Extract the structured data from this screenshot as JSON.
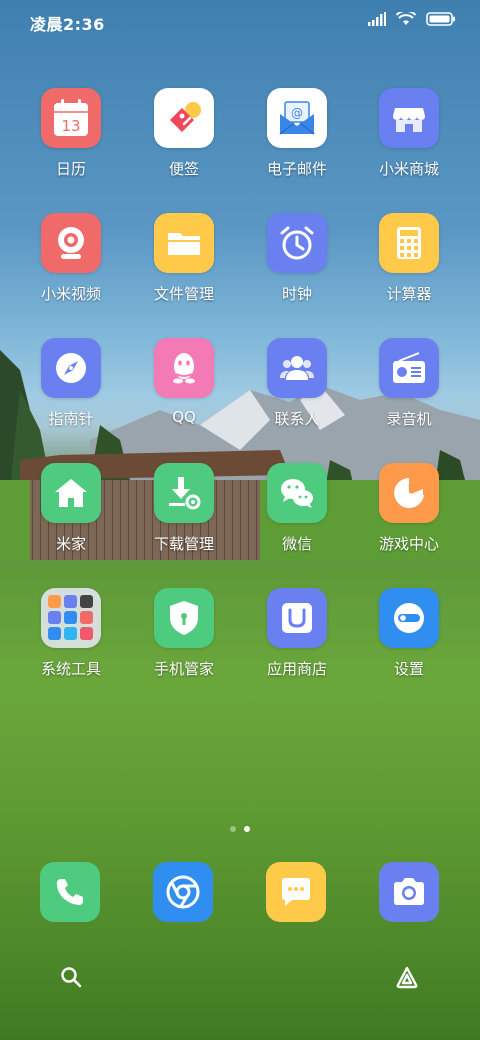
{
  "status_bar": {
    "time": "凌晨2:36"
  },
  "apps": [
    {
      "label": "日历",
      "icon": "calendar-icon",
      "color": "#f06a6a",
      "day": "13"
    },
    {
      "label": "便签",
      "icon": "notes-icon",
      "color": "#ffffff"
    },
    {
      "label": "电子邮件",
      "icon": "email-icon",
      "color": "#ffffff"
    },
    {
      "label": "小米商城",
      "icon": "store-icon",
      "color": "#6a80f0"
    },
    {
      "label": "小米视频",
      "icon": "video-icon",
      "color": "#f06a6a"
    },
    {
      "label": "文件管理",
      "icon": "folder-icon",
      "color": "#ffc94a"
    },
    {
      "label": "时钟",
      "icon": "clock-icon",
      "color": "#6a80f0"
    },
    {
      "label": "计算器",
      "icon": "calculator-icon",
      "color": "#ffc94a"
    },
    {
      "label": "指南针",
      "icon": "compass-icon",
      "color": "#6a80f0"
    },
    {
      "label": "QQ",
      "icon": "qq-icon",
      "color": "#f47ab6"
    },
    {
      "label": "联系人",
      "icon": "contacts-icon",
      "color": "#6a80f0"
    },
    {
      "label": "录音机",
      "icon": "radio-icon",
      "color": "#6a80f0"
    },
    {
      "label": "米家",
      "icon": "home-icon",
      "color": "#4ecb7e"
    },
    {
      "label": "下载管理",
      "icon": "download-icon",
      "color": "#4ecb7e"
    },
    {
      "label": "微信",
      "icon": "wechat-icon",
      "color": "#4ecb7e"
    },
    {
      "label": "游戏中心",
      "icon": "game-icon",
      "color": "#ff9a4a"
    },
    {
      "label": "系统工具",
      "icon": "folder-grid-icon",
      "color": "#d8dde6"
    },
    {
      "label": "手机管家",
      "icon": "security-icon",
      "color": "#4ecb7e"
    },
    {
      "label": "应用商店",
      "icon": "app-store-icon",
      "color": "#6a80f0"
    },
    {
      "label": "设置",
      "icon": "settings-icon",
      "color": "#2f8ef0"
    }
  ],
  "dock": [
    {
      "name": "phone-icon",
      "color": "#4ecb7e"
    },
    {
      "name": "browser-icon",
      "color": "#2f8ef0"
    },
    {
      "name": "messages-icon",
      "color": "#ffc94a"
    },
    {
      "name": "camera-icon",
      "color": "#6a80f0"
    }
  ],
  "pages": {
    "count": 2,
    "active": 2
  }
}
